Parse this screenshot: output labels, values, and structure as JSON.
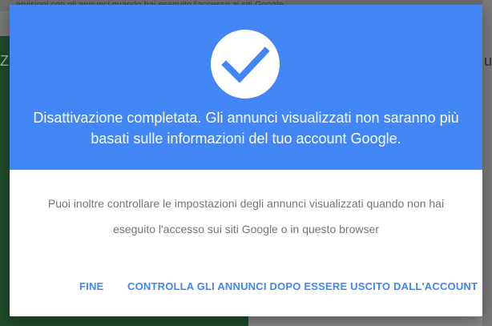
{
  "background": {
    "top_text": "ervisioni con gli annunci quando hai eseguito l'accesso ai siti Google",
    "left_char": "Z",
    "right_char": "u"
  },
  "dialog": {
    "icon": "check-icon",
    "title": "Disattivazione completata. Gli annunci visualizzati non saranno più basati sulle informazioni del tuo account Google.",
    "body": "Puoi inoltre controllare le impostazioni degli annunci visualizzati quando non hai eseguito l'accesso sui siti Google o in questo browser",
    "actions": {
      "done_label": "FINE",
      "control_ads_label": "CONTROLLA GLI ANNUNCI DOPO ESSERE USCITO DALL'ACCOUNT"
    }
  },
  "colors": {
    "header_blue": "#4285f4",
    "button_blue": "#4285f4",
    "body_text": "#757575"
  }
}
